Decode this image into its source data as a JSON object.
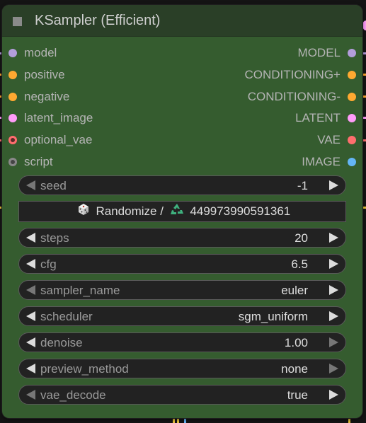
{
  "node": {
    "title": "KSampler (Efficient)"
  },
  "inputs": [
    {
      "label": "model",
      "color": "#b39ddb"
    },
    {
      "label": "positive",
      "color": "#ffa931"
    },
    {
      "label": "negative",
      "color": "#ffa931"
    },
    {
      "label": "latent_image",
      "color": "#ff9cf9"
    },
    {
      "label": "optional_vae",
      "color": "#ff6e6e"
    },
    {
      "label": "script",
      "color": "#888888"
    }
  ],
  "outputs": [
    {
      "label": "MODEL",
      "color": "#b39ddb"
    },
    {
      "label": "CONDITIONING+",
      "color": "#ffa931"
    },
    {
      "label": "CONDITIONING-",
      "color": "#ffa931"
    },
    {
      "label": "LATENT",
      "color": "#ff9cf9"
    },
    {
      "label": "VAE",
      "color": "#ff6e6e"
    },
    {
      "label": "IMAGE",
      "color": "#64b5f6"
    }
  ],
  "widgets": {
    "seed": {
      "name": "seed",
      "value": "-1"
    },
    "randomize": {
      "label_left": "Randomize /",
      "label_right": "449973990591361",
      "dice_icon": "dice-icon",
      "recycle_icon": "recycle-icon"
    },
    "steps": {
      "name": "steps",
      "value": "20"
    },
    "cfg": {
      "name": "cfg",
      "value": "6.5"
    },
    "sampler_name": {
      "name": "sampler_name",
      "value": "euler"
    },
    "scheduler": {
      "name": "scheduler",
      "value": "sgm_uniform"
    },
    "denoise": {
      "name": "denoise",
      "value": "1.00"
    },
    "preview_method": {
      "name": "preview_method",
      "value": "none"
    },
    "vae_decode": {
      "name": "vae_decode",
      "value": "true"
    }
  },
  "colors": {
    "node_body": "#355c2f",
    "node_title": "#2a3f27",
    "widget_bg": "#222222"
  }
}
